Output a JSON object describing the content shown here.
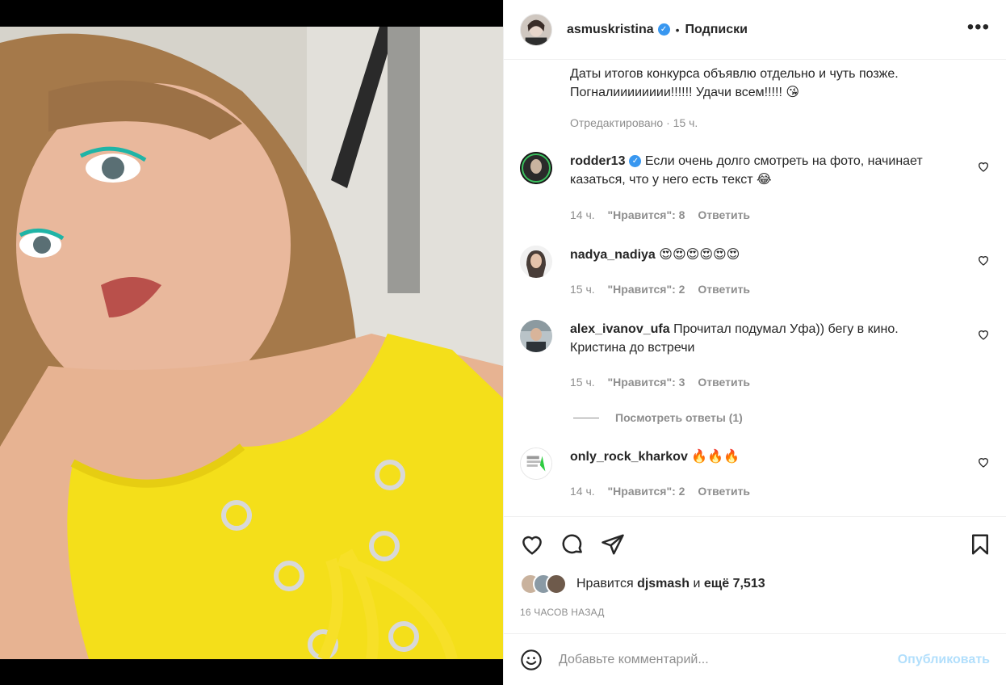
{
  "post": {
    "author": "asmuskristina",
    "follow_label": "Подписки",
    "more_label": "•••"
  },
  "caption": {
    "text_line1": "Даты итогов конкурса объявлю отдельно и чуть позже.",
    "text_line2": "Погналииииииии!!!!!! Удачи всем!!!!! 😘",
    "edited": "Отредактировано",
    "time": "15 ч."
  },
  "comments": [
    {
      "user": "rodder13",
      "verified": true,
      "text": "Если очень долго смотреть на фото, начинает казаться, что у него есть текст 😂",
      "time": "14 ч.",
      "likes": "\"Нравится\": 8",
      "reply": "Ответить"
    },
    {
      "user": "nadya_nadiya",
      "verified": false,
      "text": "😍😍😍😍😍😍",
      "time": "15 ч.",
      "likes": "\"Нравится\": 2",
      "reply": "Ответить"
    },
    {
      "user": "alex_ivanov_ufa",
      "verified": false,
      "text": "Прочитал подумал Уфа)) бегу в кино. Кристина до встречи",
      "time": "15 ч.",
      "likes": "\"Нравится\": 3",
      "reply": "Ответить"
    },
    {
      "user": "only_rock_kharkov",
      "verified": false,
      "text": "🔥🔥🔥",
      "time": "14 ч.",
      "likes": "\"Нравится\": 2",
      "reply": "Ответить"
    }
  ],
  "view_replies": "Посмотреть ответы (1)",
  "likes": {
    "prefix": "Нравится",
    "user": "djsmash",
    "connector": "и",
    "count": "ещё 7,513"
  },
  "timestamp": "16 ЧАСОВ НАЗАД",
  "add_comment": {
    "placeholder": "Добавьте комментарий...",
    "publish": "Опубликовать"
  },
  "icons": {
    "verified": "verified-badge-icon",
    "like": "heart-icon",
    "comment": "comment-icon",
    "share": "paper-plane-icon",
    "save": "bookmark-icon",
    "emoji": "smiley-icon"
  },
  "colors": {
    "verified": "#3897f0",
    "publish_disabled": "#b2dffc",
    "muted": "#8e8e8e",
    "text": "#262626"
  }
}
